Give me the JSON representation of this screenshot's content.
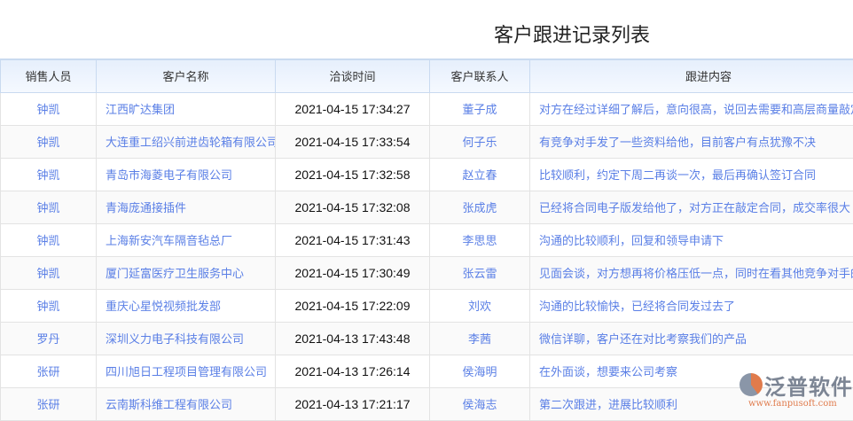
{
  "title": "客户跟进记录列表",
  "columns": [
    "销售人员",
    "客户名称",
    "洽谈时间",
    "客户联系人",
    "跟进内容"
  ],
  "rows": [
    [
      "钟凯",
      "江西旷达集团",
      "2021-04-15 17:34:27",
      "董子成",
      "对方在经过详细了解后，意向很高，说回去需要和高层商量敲定"
    ],
    [
      "钟凯",
      "大连重工绍兴前进齿轮箱有限公司",
      "2021-04-15 17:33:54",
      "何子乐",
      "有竞争对手发了一些资料给他，目前客户有点犹豫不决"
    ],
    [
      "钟凯",
      "青岛市海菱电子有限公司",
      "2021-04-15 17:32:58",
      "赵立春",
      "比较顺利，约定下周二再谈一次，最后再确认签订合同"
    ],
    [
      "钟凯",
      "青海庞通接插件",
      "2021-04-15 17:32:08",
      "张成虎",
      "已经将合同电子版发给他了，对方正在敲定合同，成交率很大"
    ],
    [
      "钟凯",
      "上海新安汽车隔音毡总厂",
      "2021-04-15 17:31:43",
      "李思思",
      "沟通的比较顺利，回复和领导申请下"
    ],
    [
      "钟凯",
      "厦门延富医疗卫生服务中心",
      "2021-04-15 17:30:49",
      "张云雷",
      "见面会谈，对方想再将价格压低一点，同时在看其他竞争对手的"
    ],
    [
      "钟凯",
      "重庆心星悦视频批发部",
      "2021-04-15 17:22:09",
      "刘欢",
      "沟通的比较愉快，已经将合同发过去了"
    ],
    [
      "罗丹",
      "深圳义力电子科技有限公司",
      "2021-04-13 17:43:48",
      "李茜",
      "微信详聊，客户还在对比考察我们的产品"
    ],
    [
      "张研",
      "四川旭日工程项目管理有限公司",
      "2021-04-13 17:26:14",
      "侯海明",
      "在外面谈，想要来公司考察"
    ],
    [
      "张研",
      "云南斯科维工程有限公司",
      "2021-04-13 17:21:17",
      "侯海志",
      "第二次跟进，进展比较顺利"
    ]
  ],
  "logo": {
    "name": "泛普软件",
    "url": "www.fanpusoft.com"
  }
}
